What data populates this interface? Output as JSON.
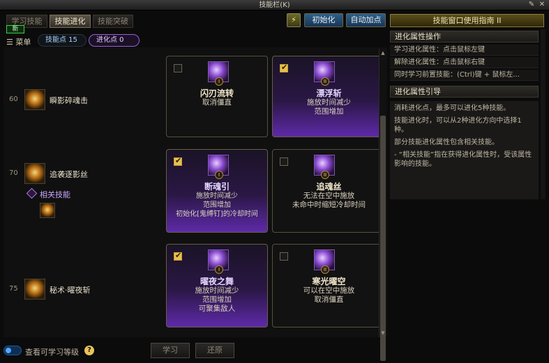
{
  "window": {
    "title": "技能栏(K)"
  },
  "tabs": [
    {
      "label": "学习技能",
      "active": false
    },
    {
      "label": "技能进化",
      "active": true
    },
    {
      "label": "技能突破",
      "active": false
    }
  ],
  "new_badge": "新",
  "toolbar": {
    "reset_label": "初始化",
    "auto_label": "自动加点"
  },
  "header": {
    "menu_label": "菜单",
    "skill_points": "技能点 15",
    "evolution_points": "进化点 0"
  },
  "skills": [
    {
      "level": "60",
      "name": "瞬影碎魂击",
      "cards": [
        {
          "checked": false,
          "selected": false,
          "roman": "I",
          "title": "闪刃流转",
          "desc": [
            "取消僵直"
          ]
        },
        {
          "checked": true,
          "selected": true,
          "roman": "II",
          "title": "漂浮斩",
          "desc": [
            "施放时间减少",
            "范围增加"
          ]
        }
      ]
    },
    {
      "level": "70",
      "name": "追袭逐影丝",
      "related": "相关技能",
      "cards": [
        {
          "checked": true,
          "selected": true,
          "roman": "I",
          "title": "断魂引",
          "desc": [
            "施放时间减少",
            "范围增加",
            "初始化[鬼缚钉]的冷却时间"
          ]
        },
        {
          "checked": false,
          "selected": false,
          "roman": "II",
          "title": "追魂丝",
          "desc": [
            "无法在空中施放",
            "未命中时缩短冷却时间"
          ]
        }
      ]
    },
    {
      "level": "75",
      "name": "秘术·曜夜斩",
      "cards": [
        {
          "checked": true,
          "selected": true,
          "roman": "I",
          "title": "曜夜之舞",
          "desc": [
            "施放时间减少",
            "范围增加",
            "可聚集敌人"
          ]
        },
        {
          "checked": false,
          "selected": false,
          "roman": "II",
          "title": "寒光曜空",
          "desc": [
            "可以在空中施放",
            "取消僵直"
          ]
        }
      ]
    }
  ],
  "footer": {
    "toggle_label": "查看可学习等级",
    "help": "?",
    "learn_label": "学习",
    "revert_label": "还原"
  },
  "guide": {
    "title": "技能窗口使用指南 II",
    "section1": "进化属性操作",
    "rows": [
      "学习进化属性：点击鼠标左键",
      "解除进化属性：点击鼠标右键",
      "同时学习前置技能：(Ctrl)键 + 鼠标左..."
    ],
    "section2": "进化属性引导",
    "paragraphs": [
      "消耗进化点，最多可以进化5种技能。",
      "技能进化时，可以从2种进化方向中选择1种。",
      "部分技能进化属性包含相关技能。",
      "- “相关技能”指在获得进化属性时，受该属性影响的技能。"
    ]
  },
  "colors": {
    "accent_purple": "#9a60d6",
    "check_gold": "#e5c050",
    "panel_bg": "#101010"
  }
}
